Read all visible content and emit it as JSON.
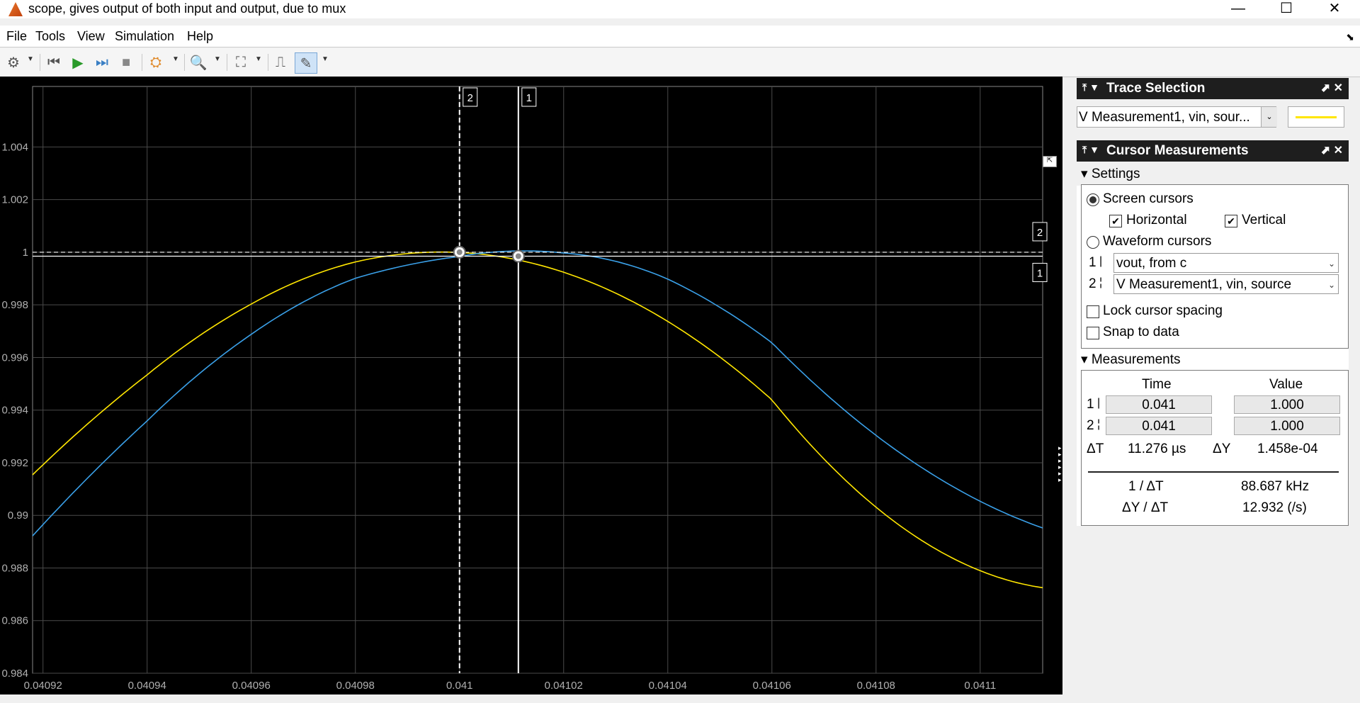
{
  "window": {
    "title": "scope, gives output of both input and output, due to mux",
    "minimize": "—",
    "maximize": "☐",
    "close": "✕"
  },
  "menu": [
    "File",
    "Tools",
    "View",
    "Simulation",
    "Help"
  ],
  "toolbar": {
    "icons": [
      "gear-icon",
      "step-back-icon",
      "run-icon",
      "step-forward-icon",
      "stop-icon",
      "highlight-icon",
      "zoom-icon",
      "fit-to-view-icon",
      "triggers-icon",
      "cursor-measurements-icon"
    ]
  },
  "chart_data": {
    "type": "line",
    "xlim": [
      0.040918,
      0.041112
    ],
    "ylim": [
      0.984,
      1.0063
    ],
    "xticks": [
      0.04092,
      0.04094,
      0.04096,
      0.04098,
      0.041,
      0.04102,
      0.04104,
      0.04106,
      0.04108,
      0.0411
    ],
    "xtick_labels": [
      "0.04092",
      "0.04094",
      "0.04096",
      "0.04098",
      "0.041",
      "0.04102",
      "0.04104",
      "0.04106",
      "0.04108",
      "0.0411"
    ],
    "yticks": [
      0.984,
      0.986,
      0.988,
      0.99,
      0.992,
      0.994,
      0.996,
      0.998,
      1,
      1.002,
      1.004
    ],
    "ytick_labels": [
      "0.984",
      "0.986",
      "0.988",
      "0.99",
      "0.992",
      "0.994",
      "0.996",
      "0.998",
      "1",
      "1.002",
      "1.004"
    ],
    "grid": true,
    "series": [
      {
        "color": "#ffe600",
        "x": [
          0.040918,
          0.04094,
          0.04096,
          0.04098,
          0.041,
          0.04102,
          0.04104,
          0.04106,
          0.04108,
          0.041112
        ],
        "y": [
          0.99154,
          0.99534,
          0.99803,
          0.99963,
          0.99999,
          0.99924,
          0.99737,
          0.99439,
          0.99031,
          0.98725
        ]
      },
      {
        "color": "#3aa0e8",
        "x": [
          0.040918,
          0.04094,
          0.04096,
          0.04098,
          0.041,
          0.04102,
          0.04104,
          0.04106,
          0.04108,
          0.041112
        ],
        "y": [
          0.98922,
          0.99359,
          0.99688,
          0.99901,
          0.99984,
          0.99997,
          0.99898,
          0.99656,
          0.99304,
          0.98952
        ]
      }
    ],
    "cursors": {
      "vertical": [
        {
          "label": "2",
          "x": 0.041,
          "style": "dashed"
        },
        {
          "label": "1",
          "x": 0.0410113,
          "style": "solid"
        }
      ],
      "horizontal": [
        {
          "label": "2",
          "y": 1.0,
          "style": "dashed"
        },
        {
          "label": "1",
          "y": 0.99985,
          "style": "solid"
        }
      ]
    }
  },
  "trace_selection": {
    "title": "Trace Selection",
    "selected": "V Measurement1, vin, sour...",
    "color": "#ffe600"
  },
  "cursor_measurements": {
    "title": "Cursor Measurements",
    "settings_label": "Settings",
    "screen_cursors": "Screen cursors",
    "horizontal": "Horizontal",
    "vertical": "Vertical",
    "waveform_cursors": "Waveform cursors",
    "cursor1_index": "1",
    "cursor2_index": "2",
    "cursor1_signal": "vout, from c",
    "cursor2_signal": "V Measurement1, vin, source",
    "lock_spacing": "Lock cursor spacing",
    "snap_to_data": "Snap to data",
    "measurements_label": "Measurements",
    "time_header": "Time",
    "value_header": "Value",
    "c1_time": "0.041",
    "c1_value": "1.000",
    "c2_time": "0.041",
    "c2_value": "1.000",
    "dT_label": "ΔT",
    "dT_value": "11.276 µs",
    "dY_label": "ΔY",
    "dY_value": "1.458e-04",
    "inv_dT_label": "1 / ΔT",
    "inv_dT_value": "88.687 kHz",
    "dYdT_label": "ΔY / ΔT",
    "dYdT_value": "12.932 (/s)"
  }
}
